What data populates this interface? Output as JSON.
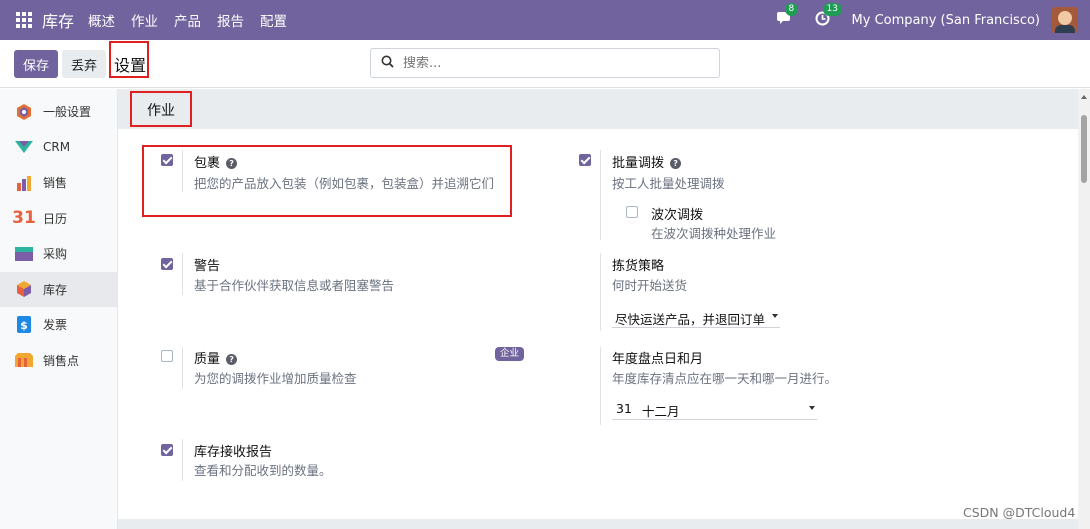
{
  "navbar": {
    "app_name": "库存",
    "menu": [
      "概述",
      "作业",
      "产品",
      "报告",
      "配置"
    ],
    "messages_count": "8",
    "activities_count": "13",
    "company": "My Company (San Francisco)"
  },
  "control": {
    "save_label": "保存",
    "discard_label": "丢弃",
    "title": "设置",
    "search_placeholder": "搜索..."
  },
  "sidebar": {
    "items": [
      {
        "label": "一般设置",
        "icon": "gear-hex-icon",
        "color": "#e46f32"
      },
      {
        "label": "CRM",
        "icon": "crm-icon",
        "color": "#2eb5a0"
      },
      {
        "label": "销售",
        "icon": "sales-chart-icon",
        "color": "#e8603c"
      },
      {
        "label": "日历",
        "icon": "calendar-icon",
        "color": "#e8603c"
      },
      {
        "label": "采购",
        "icon": "purchase-icon",
        "color": "#2eb5a0"
      },
      {
        "label": "库存",
        "icon": "inventory-box-icon",
        "color": "#e8603c"
      },
      {
        "label": "发票",
        "icon": "invoice-icon",
        "color": "#1e88e5"
      },
      {
        "label": "销售点",
        "icon": "pos-icon",
        "color": "#f0a830"
      }
    ],
    "active_index": 5
  },
  "section": {
    "title": "作业"
  },
  "settings": {
    "packages": {
      "label": "包裹",
      "desc": "把您的产品放入包装（例如包裹，包装盒）并追溯它们",
      "checked": true
    },
    "batch_transfers": {
      "label": "批量调拨",
      "desc": "按工人批量处理调拨",
      "checked": true
    },
    "wave_transfers": {
      "label": "波次调拨",
      "desc": "在波次调拨种处理作业",
      "checked": false
    },
    "warnings": {
      "label": "警告",
      "desc": "基于合作伙伴获取信息或者阻塞警告",
      "checked": true
    },
    "picking_policy": {
      "label": "拣货策略",
      "desc": "何时开始送货",
      "value": "尽快运送产品，并退回订单"
    },
    "quality": {
      "label": "质量",
      "desc": "为您的调拨作业增加质量检查",
      "checked": false,
      "badge": "企业"
    },
    "annual_inventory": {
      "label": "年度盘点日和月",
      "desc": "年度库存清点应在哪一天和哪一月进行。",
      "day": "31",
      "month": "十二月"
    },
    "reception_report": {
      "label": "库存接收报告",
      "desc": "查看和分配收到的数量。",
      "checked": true
    }
  },
  "watermark": "CSDN @DTCloud4"
}
